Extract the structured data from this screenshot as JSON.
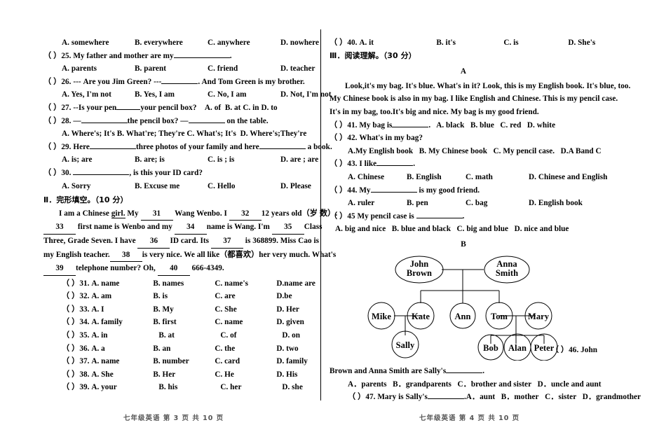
{
  "document": {
    "type": "english-exam-paper",
    "footer_left": "七年级英语    第 3 页    共 10 页",
    "footer_right": "七年级英语    第 4 页    共 10 页"
  },
  "left_column": {
    "q24_options": {
      "a": "A. somewhere",
      "b": "B. everywhere",
      "c": "C. anywhere",
      "d": "D. nowhere"
    },
    "q25": {
      "marker": "（   ）25.",
      "stem": "My father and mother are my",
      "tail": ".",
      "a": "A. parents",
      "b": "B. parent",
      "c": "C. friend",
      "d": "D. teacher"
    },
    "q26": {
      "marker": "（   ）26.",
      "stem": "--- Are you Jim Green?   ---",
      "tail": ". And Tom Green is my brother.",
      "a": "A. Yes, I'm not",
      "b": "B. Yes, I am",
      "c": "C. No, I am",
      "d": "D. Not, I'm not"
    },
    "q27": {
      "marker": "（   ）27.",
      "stem": "--Is your pen",
      "tail": "your pencil box?",
      "a": "A.  of",
      "b": "B.  at",
      "c": "C. in",
      "d": "D. to"
    },
    "q28": {
      "marker": "（   ）28.",
      "stem_pre": "—",
      "stem_mid": "the pencil box? —",
      "stem_post": "on the table.",
      "a": "A. Where's; It's",
      "b": "B. What're; They're",
      "c": "C. What's; It's",
      "d": "D. Where's;They're"
    },
    "q29": {
      "marker": "（   ）29.",
      "stem_pre": "Here",
      "stem_mid": "three photos of your family and here",
      "stem_post": "a book.",
      "a": "A. is; are",
      "b": "B. are; is",
      "c": "C. is ; is",
      "d": "D. are ; are"
    },
    "q30": {
      "marker": "（   ）30.",
      "stem": ", is this your ID card?",
      "a": "A. Sorry",
      "b": "B. Excuse me",
      "c": "C. Hello",
      "d": "D. Please"
    },
    "section2_title": "Ⅱ．完形填空。（10 分）",
    "cloze_passage": {
      "line1_pre": "I am a Chinese ",
      "line1_underline": "girl.",
      "line1_a": " My",
      "blank31": "31",
      "line1_b": "Wang Wenbo. I",
      "blank32": "32",
      "line1_c": "12 years old（岁 数）.",
      "blank33": "33",
      "line2_a": "first name is Wenbo and my",
      "blank34": "34",
      "line2_b": "name is Wang. I'm",
      "blank35": "35",
      "line2_c": "Class",
      "line3_a": "Three, Grade Seven. I have",
      "blank36": "36",
      "line3_b": "ID card. Its",
      "blank37": "37",
      "line3_c": "is 368899. Miss Cao is",
      "line4_a": "my English teacher.",
      "blank38": "38",
      "line4_b": "is very nice. We all like（都喜欢）her very much. What's",
      "blank39": "39",
      "line5_a": "telephone number? Oh,",
      "blank40": "40",
      "line5_b": "666-4349."
    },
    "cloze_options": [
      {
        "marker": "（   ）31.",
        "a": "A. name",
        "b": "B. names",
        "c": "C. name's",
        "d": "D.name are"
      },
      {
        "marker": "（   ）32.",
        "a": "A. am",
        "b": "B. is",
        "c": "C. are",
        "d": "D.be"
      },
      {
        "marker": "（   ）33.",
        "a": "A. I",
        "b": "B. My",
        "c": "C. She",
        "d": "D. Her"
      },
      {
        "marker": "（   ）34.",
        "a": "A. family",
        "b": "B. first",
        "c": "C. name",
        "d": "D. given"
      },
      {
        "marker": "（   ）35.",
        "a": "A. in",
        "b": "B. at",
        "c": "C. of",
        "d": "D. on"
      },
      {
        "marker": "（   ）36.",
        "a": "A. a",
        "b": "B. an",
        "c": "C. the",
        "d": "D. two"
      },
      {
        "marker": "（   ）37.",
        "a": "A. name",
        "b": "B. number",
        "c": "C. card",
        "d": "D. family"
      },
      {
        "marker": "（   ）38.",
        "a": "A. She",
        "b": "B. Her",
        "c": "C. He",
        "d": "D. His"
      },
      {
        "marker": "（   ）39.",
        "a": "A. your",
        "b": "B. his",
        "c": "C. her",
        "d": "D. she"
      }
    ]
  },
  "right_column": {
    "q40": {
      "marker": "（   ）40.",
      "a": "A. it",
      "b": "B. it's",
      "c": "C. is",
      "d": "D. She's"
    },
    "section3_title": "Ⅲ．阅读理解。（30 分）",
    "passage_a_label": "A",
    "passage_a": {
      "line1": "Look,it's my bag. It's blue. What's in it? Look, this is my English book. It's blue, too.",
      "line2": "My Chinese book is also in my bag. I like English and Chinese. This is my pencil case.",
      "line3": "It's in my bag, too.It's big and nice. My bag is my good friend."
    },
    "q41": {
      "marker": "（   ）41.",
      "stem": "My bag is",
      "tail": ".",
      "a": "A. black",
      "b": "B. blue",
      "c": "C. red",
      "d": "D. white"
    },
    "q42": {
      "marker": "（   ）42.",
      "stem": "What's in my bag?",
      "a": "A.My English book",
      "b": "B. My Chinese book",
      "c": "C. My pencil case.",
      "d": "D.A Band C"
    },
    "q43": {
      "marker": "（   ）43.",
      "stem": "I like",
      "tail": ".",
      "a": "A. Chinese",
      "b": "B. English",
      "c": "C. math",
      "d": "D. Chinese and English"
    },
    "q44": {
      "marker": "（   ）44.",
      "stem_pre": "My",
      "stem_post": "is my good friend.",
      "a": "A. ruler",
      "b": "B. pen",
      "c": "C. bag",
      "d": "D. English book"
    },
    "q45": {
      "marker": "（   ）45",
      "stem": "My pencil case is",
      "tail": ".",
      "a": "A. big and nice",
      "b": "B. blue and black",
      "c": "C. big and blue",
      "d": "D. nice and blue"
    },
    "passage_b_label": "B",
    "family_tree": {
      "generation1": [
        "John Brown",
        "Anna Smith"
      ],
      "generation2": [
        "Mike",
        "Kate",
        "Ann",
        "Tom",
        "Mary"
      ],
      "generation3": [
        "Sally",
        "Bob",
        "Alan",
        "Peter"
      ]
    },
    "q46": {
      "marker": "（   ）46.",
      "stem_line1": "John",
      "stem_line2": "Brown and Anna Smith are Sally's",
      "tail": ".",
      "a": "A．parents",
      "b": "B．grandparents",
      "c": "C．brother and sister",
      "d": "D．uncle and aunt"
    },
    "q47": {
      "marker": "（   ）47.",
      "stem": "Mary is Sally's",
      "tail": ".",
      "a": "A．aunt",
      "b": "B．mother",
      "c": "C．sister",
      "d": "D．grandmother"
    }
  }
}
